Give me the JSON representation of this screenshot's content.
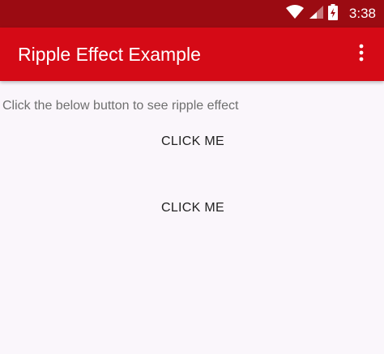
{
  "status_bar": {
    "time": "3:38",
    "icons": [
      "wifi-icon",
      "cellular-signal-icon",
      "battery-charging-icon"
    ]
  },
  "app_bar": {
    "title": "Ripple Effect Example",
    "overflow_icon": "more-vert-icon"
  },
  "main": {
    "description": "Click the below button to see ripple effect",
    "buttons": [
      {
        "label": "CLICK ME"
      },
      {
        "label": "CLICK ME"
      }
    ]
  },
  "colors": {
    "status_bar": "#9b0b12",
    "app_bar": "#d50a16",
    "background": "#faf6fb"
  }
}
